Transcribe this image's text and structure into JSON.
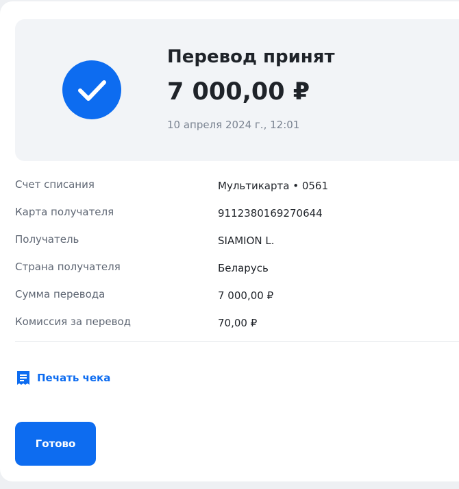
{
  "success": {
    "title": "Перевод принят",
    "amount": "7 000,00 ₽",
    "datetime": "10 апреля 2024 г., 12:01"
  },
  "details": [
    {
      "label": "Счет списания",
      "value": "Мультикарта • 0561"
    },
    {
      "label": "Карта получателя",
      "value": "9112380169270644"
    },
    {
      "label": "Получатель",
      "value": "SIAMION L."
    },
    {
      "label": "Страна получателя",
      "value": "Беларусь"
    },
    {
      "label": "Сумма перевода",
      "value": "7 000,00 ₽"
    },
    {
      "label": "Комиссия за перевод",
      "value": "70,00 ₽"
    }
  ],
  "actions": {
    "print_receipt": "Печать чека",
    "done": "Готово"
  },
  "icons": {
    "status": "check-circle-icon",
    "print": "receipt-icon"
  },
  "colors": {
    "accent": "#0d6cf0",
    "text": "#1f2329",
    "muted": "#7a8391"
  }
}
